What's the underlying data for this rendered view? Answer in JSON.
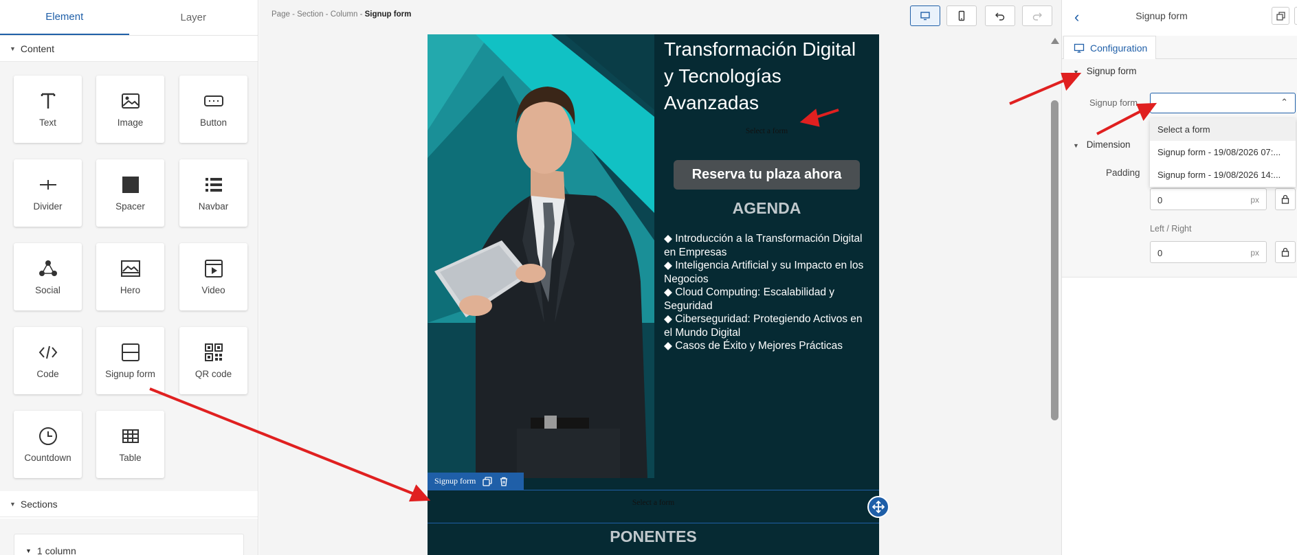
{
  "left_panel": {
    "tabs": [
      "Element",
      "Layer"
    ],
    "content_label": "Content",
    "tiles": [
      {
        "label": "Text",
        "icon": "text-icon"
      },
      {
        "label": "Image",
        "icon": "image-icon"
      },
      {
        "label": "Button",
        "icon": "button-icon"
      },
      {
        "label": "Divider",
        "icon": "divider-icon"
      },
      {
        "label": "Spacer",
        "icon": "spacer-icon"
      },
      {
        "label": "Navbar",
        "icon": "navbar-icon"
      },
      {
        "label": "Social",
        "icon": "social-icon"
      },
      {
        "label": "Hero",
        "icon": "hero-icon"
      },
      {
        "label": "Video",
        "icon": "video-icon"
      },
      {
        "label": "Code",
        "icon": "code-icon"
      },
      {
        "label": "Signup form",
        "icon": "signup-form-icon"
      },
      {
        "label": "QR code",
        "icon": "qr-code-icon"
      },
      {
        "label": "Countdown",
        "icon": "countdown-icon"
      },
      {
        "label": "Table",
        "icon": "table-icon"
      }
    ],
    "sections_label": "Sections",
    "column_item": "1 column"
  },
  "canvas": {
    "breadcrumb": {
      "items": [
        "Page",
        "Section",
        "Column"
      ],
      "separator": "-",
      "current": "Signup form"
    },
    "page": {
      "heading": "Transformación Digital y Tecnologías Avanzadas",
      "form_placeholder": "Select a form",
      "cta_label": "Reserva tu plaza ahora",
      "agenda_title": "AGENDA",
      "agenda_items": [
        "◆ Introducción a la Transformación Digital en Empresas",
        "◆ Inteligencia Artificial y su Impacto en los Negocios",
        "◆ Cloud Computing: Escalabilidad y Seguridad",
        "◆ Ciberseguridad: Protegiendo Activos en el Mundo Digital",
        "◆ Casos de Éxito y Mejores Prácticas"
      ],
      "selected_block_label": "Signup form",
      "selected_block_placeholder": "Select a form",
      "next_section_title": "PONENTES"
    }
  },
  "right_panel": {
    "title": "Signup form",
    "tab": "Configuration",
    "group_signup": "Signup form",
    "signup_field_label": "Signup form",
    "signup_select_value": "",
    "dropdown_options": [
      "Select a form",
      "Signup form - 19/08/2026 07:...",
      "Signup form - 19/08/2026 14:..."
    ],
    "group_dimension": "Dimension",
    "padding_label": "Padding",
    "padding_top_value": "0",
    "left_right_label": "Left / Right",
    "left_right_value": "0",
    "unit": "px"
  },
  "colors": {
    "accent": "#1f5fa8",
    "page_bg": "#062a33",
    "annotation_arrow": "#e02020"
  }
}
